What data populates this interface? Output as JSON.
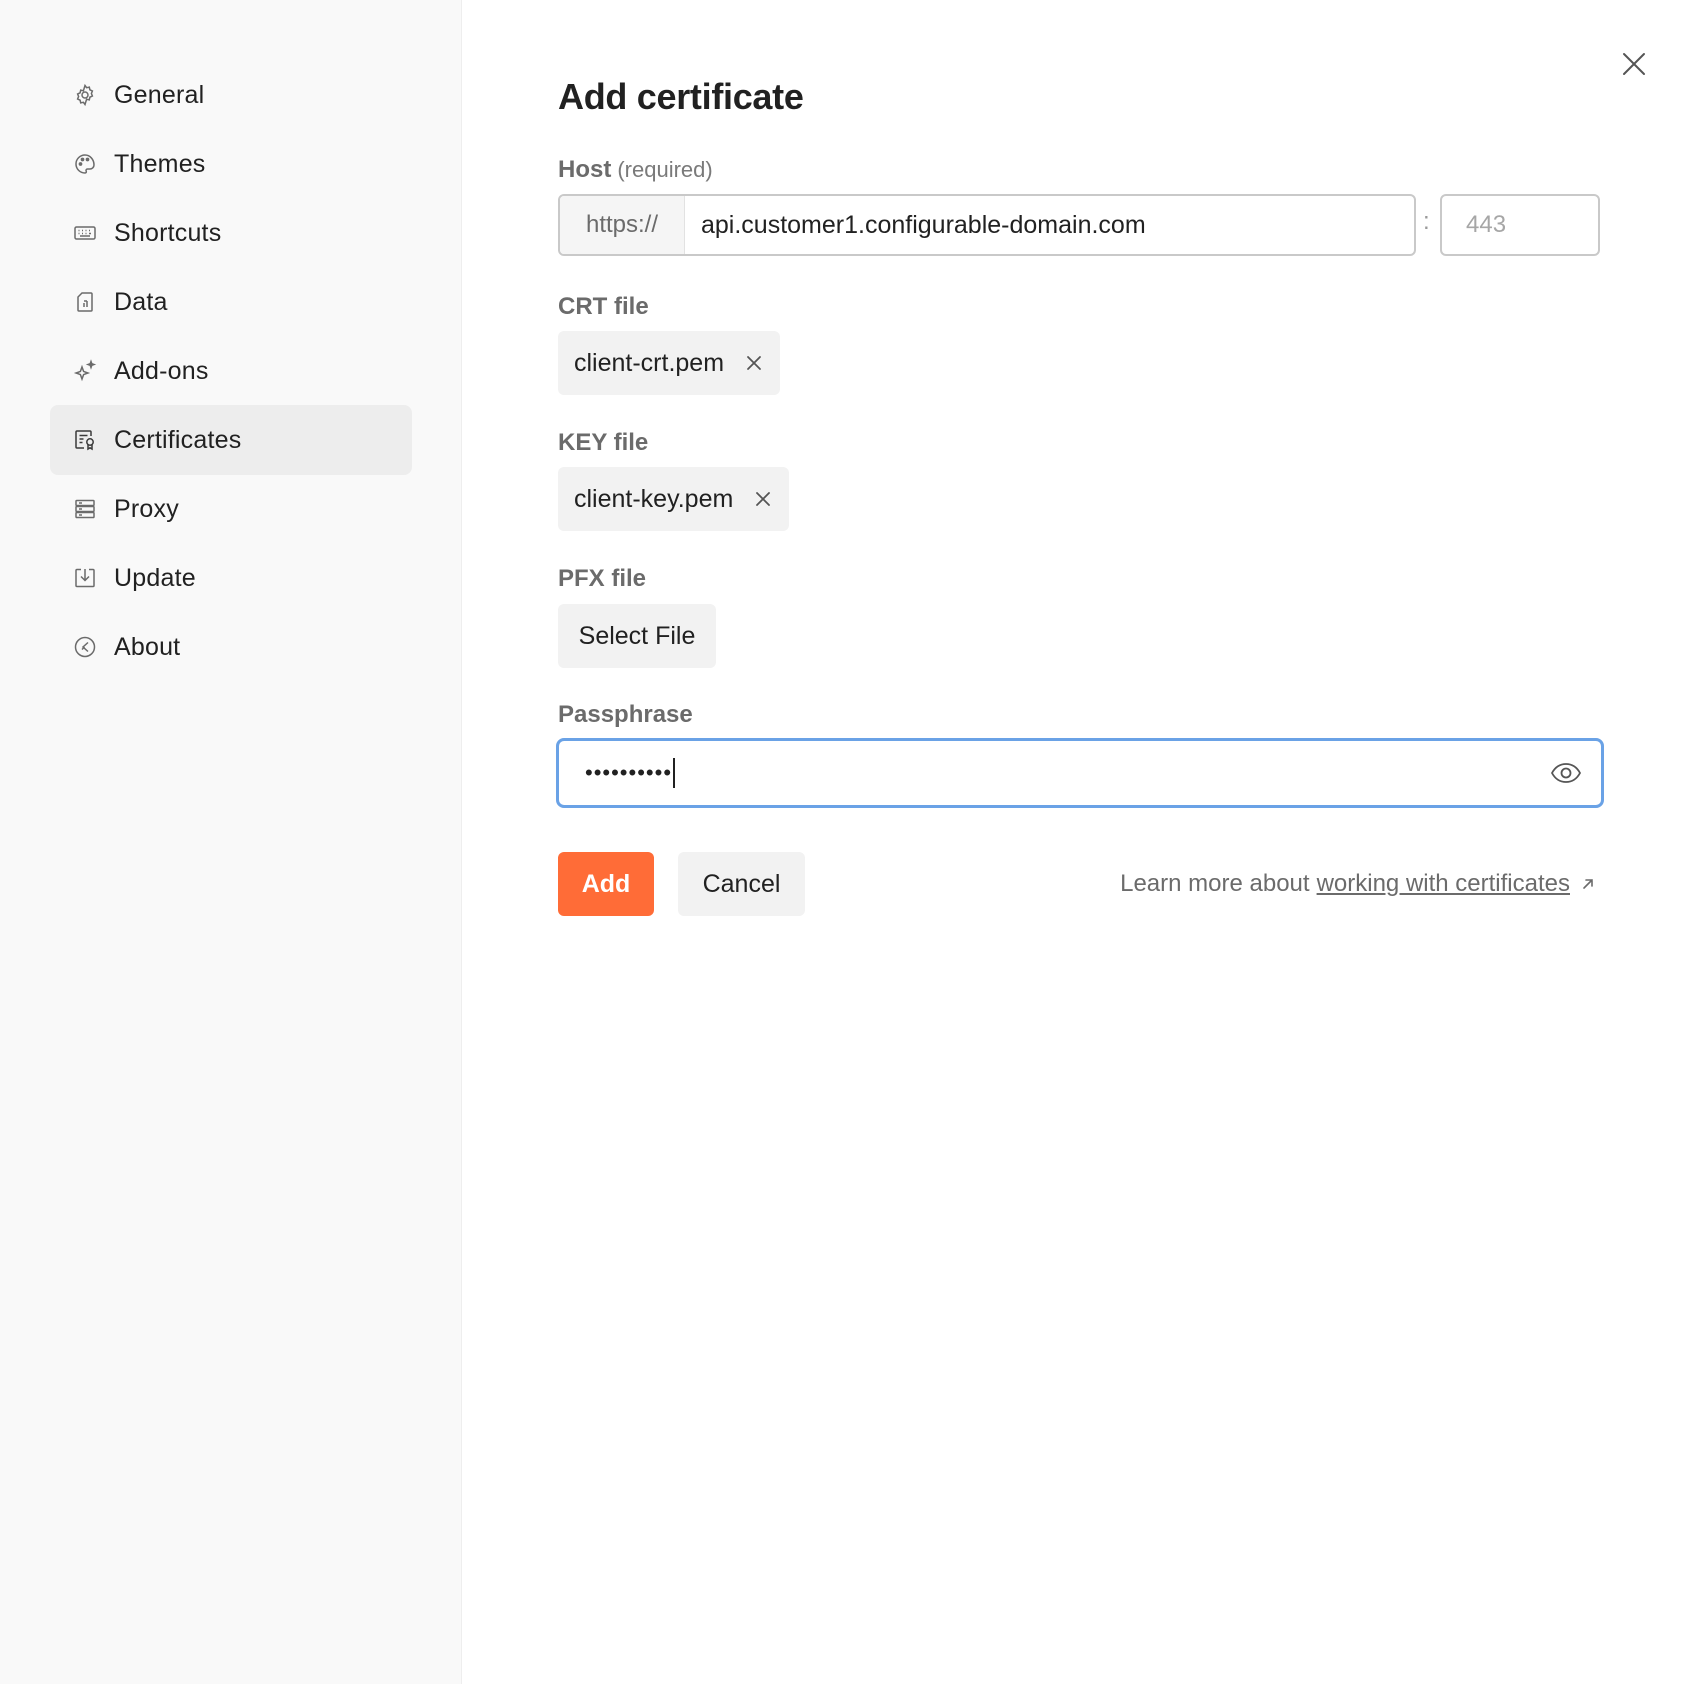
{
  "sidebar": {
    "items": [
      {
        "label": "General",
        "icon": "gear-icon"
      },
      {
        "label": "Themes",
        "icon": "palette-icon"
      },
      {
        "label": "Shortcuts",
        "icon": "keyboard-icon"
      },
      {
        "label": "Data",
        "icon": "data-icon"
      },
      {
        "label": "Add-ons",
        "icon": "sparkle-icon"
      },
      {
        "label": "Certificates",
        "icon": "certificate-icon",
        "active": true
      },
      {
        "label": "Proxy",
        "icon": "server-icon"
      },
      {
        "label": "Update",
        "icon": "download-icon"
      },
      {
        "label": "About",
        "icon": "info-icon"
      }
    ]
  },
  "dialog": {
    "title": "Add certificate",
    "host": {
      "label": "Host",
      "sublabel": "(required)",
      "prefix": "https://",
      "value": "api.customer1.configurable-domain.com",
      "separator": ":",
      "port_placeholder": "443"
    },
    "crt": {
      "label": "CRT file",
      "filename": "client-crt.pem"
    },
    "key": {
      "label": "KEY file",
      "filename": "client-key.pem"
    },
    "pfx": {
      "label": "PFX file",
      "button": "Select File"
    },
    "passphrase": {
      "label": "Passphrase",
      "masked_value": "••••••••••"
    },
    "actions": {
      "add": "Add",
      "cancel": "Cancel"
    },
    "learn_more": {
      "prefix": "Learn more about",
      "link": "working with certificates"
    }
  },
  "colors": {
    "accent": "#ff6c37",
    "focus_ring": "#6aa2e6",
    "sidebar_bg": "#f9f9f9",
    "active_item_bg": "#ededed"
  }
}
